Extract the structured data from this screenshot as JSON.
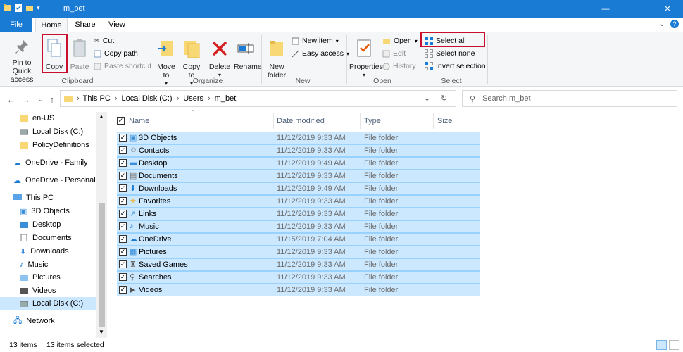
{
  "window": {
    "title": "m_bet",
    "minimize": "—",
    "maximize": "☐",
    "close": "✕"
  },
  "tabs": {
    "file": "File",
    "home": "Home",
    "share": "Share",
    "view": "View"
  },
  "ribbon": {
    "clipboard": {
      "pin": "Pin to Quick access",
      "copy": "Copy",
      "paste": "Paste",
      "cut": "Cut",
      "copy_path": "Copy path",
      "paste_shortcut": "Paste shortcut",
      "label": "Clipboard"
    },
    "organize": {
      "move_to": "Move to",
      "copy_to": "Copy to",
      "delete": "Delete",
      "rename": "Rename",
      "label": "Organize"
    },
    "new": {
      "new_folder": "New folder",
      "new_item": "New item",
      "easy_access": "Easy access",
      "label": "New"
    },
    "open": {
      "properties": "Properties",
      "open": "Open",
      "edit": "Edit",
      "history": "History",
      "label": "Open"
    },
    "select": {
      "select_all": "Select all",
      "select_none": "Select none",
      "invert": "Invert selection",
      "label": "Select"
    }
  },
  "address": {
    "crumbs": [
      "This PC",
      "Local Disk (C:)",
      "Users",
      "m_bet"
    ],
    "search_placeholder": "Search m_bet"
  },
  "nav": {
    "items": [
      "en-US",
      "Local Disk (C:)",
      "PolicyDefinitions",
      "OneDrive - Family",
      "OneDrive - Personal",
      "This PC",
      "3D Objects",
      "Desktop",
      "Documents",
      "Downloads",
      "Music",
      "Pictures",
      "Videos",
      "Local Disk (C:)",
      "Network"
    ]
  },
  "columns": {
    "name": "Name",
    "date": "Date modified",
    "type": "Type",
    "size": "Size"
  },
  "files": [
    {
      "name": "3D Objects",
      "date": "11/12/2019 9:33 AM",
      "type": "File folder"
    },
    {
      "name": "Contacts",
      "date": "11/12/2019 9:33 AM",
      "type": "File folder"
    },
    {
      "name": "Desktop",
      "date": "11/12/2019 9:49 AM",
      "type": "File folder"
    },
    {
      "name": "Documents",
      "date": "11/12/2019 9:33 AM",
      "type": "File folder"
    },
    {
      "name": "Downloads",
      "date": "11/12/2019 9:49 AM",
      "type": "File folder"
    },
    {
      "name": "Favorites",
      "date": "11/12/2019 9:33 AM",
      "type": "File folder"
    },
    {
      "name": "Links",
      "date": "11/12/2019 9:33 AM",
      "type": "File folder"
    },
    {
      "name": "Music",
      "date": "11/12/2019 9:33 AM",
      "type": "File folder"
    },
    {
      "name": "OneDrive",
      "date": "11/15/2019 7:04 AM",
      "type": "File folder"
    },
    {
      "name": "Pictures",
      "date": "11/12/2019 9:33 AM",
      "type": "File folder"
    },
    {
      "name": "Saved Games",
      "date": "11/12/2019 9:33 AM",
      "type": "File folder"
    },
    {
      "name": "Searches",
      "date": "11/12/2019 9:33 AM",
      "type": "File folder"
    },
    {
      "name": "Videos",
      "date": "11/12/2019 9:33 AM",
      "type": "File folder"
    }
  ],
  "status": {
    "count": "13 items",
    "selected": "13 items selected"
  },
  "colors": {
    "accent": "#1a7bd4",
    "selection": "#cce8ff",
    "highlight": "#c8102e"
  }
}
